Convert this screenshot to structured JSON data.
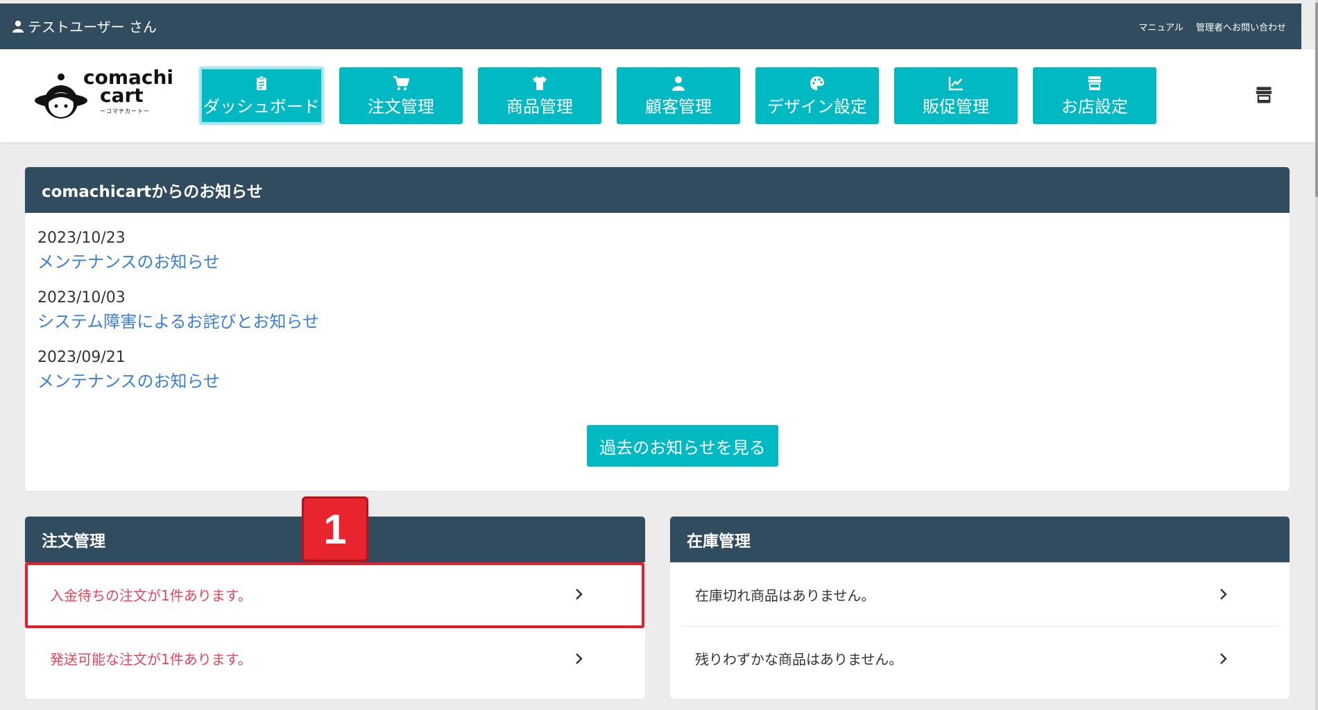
{
  "topbar": {
    "user_label": "テストユーザー さん",
    "links": [
      "マニュアル",
      "管理者へお問い合わせ"
    ]
  },
  "logo": {
    "line1": "comachi",
    "line2": "cart",
    "sub": "ーコマチカートー"
  },
  "nav": [
    {
      "label": "ダッシュボード",
      "icon": "clipboard-icon",
      "active": true
    },
    {
      "label": "注文管理",
      "icon": "cart-icon"
    },
    {
      "label": "商品管理",
      "icon": "tshirt-icon"
    },
    {
      "label": "顧客管理",
      "icon": "user-icon"
    },
    {
      "label": "デザイン設定",
      "icon": "palette-icon"
    },
    {
      "label": "販促管理",
      "icon": "chart-line-icon"
    },
    {
      "label": "お店設定",
      "icon": "store-icon"
    }
  ],
  "news": {
    "heading": "comachicartからのお知らせ",
    "items": [
      {
        "date": "2023/10/23",
        "title": "メンテナンスのお知らせ"
      },
      {
        "date": "2023/10/03",
        "title": "システム障害によるお詫びとお知らせ"
      },
      {
        "date": "2023/09/21",
        "title": "メンテナンスのお知らせ"
      }
    ],
    "more_label": "過去のお知らせを見る"
  },
  "orders": {
    "heading": "注文管理",
    "rows": [
      "入金待ちの注文が1件あります。",
      "発送可能な注文が1件あります。"
    ]
  },
  "stock": {
    "heading": "在庫管理",
    "rows": [
      "在庫切れ商品はありません。",
      "残りわずかな商品はありません。"
    ]
  },
  "annotation": {
    "badge": "1"
  },
  "colors": {
    "dark": "#314c5f",
    "accent": "#00b9c2",
    "alert": "#e8435a",
    "link": "#3a7fd5",
    "highlight": "#e21f2a"
  }
}
